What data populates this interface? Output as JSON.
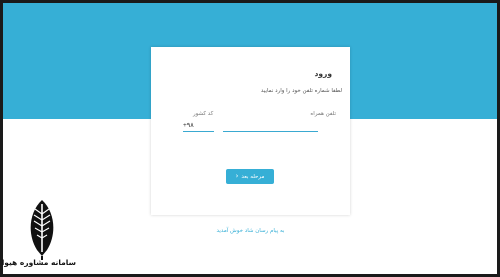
{
  "login": {
    "title": "ورود",
    "subtitle": "لطفا شماره تلفن خود را وارد نمایید",
    "phone_label": "تلفن همراه",
    "phone_value": "",
    "code_label": "کد کشور",
    "code_value": "+۹۸",
    "next_button": "مرحله بعد"
  },
  "welcome_text": "به پیام رسان شاد خوش آمدید",
  "logo": {
    "text": "سامانه مشاوره هیوا"
  },
  "colors": {
    "accent": "#36afd6",
    "background": "#ffffff"
  }
}
